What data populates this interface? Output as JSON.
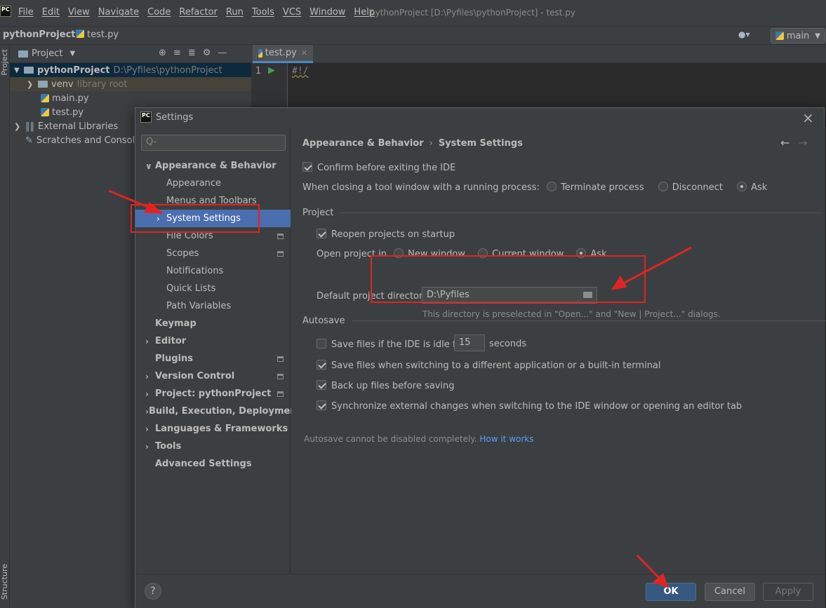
{
  "app": {
    "logo": "PC",
    "menus": [
      "File",
      "Edit",
      "View",
      "Navigate",
      "Code",
      "Refactor",
      "Run",
      "Tools",
      "VCS",
      "Window",
      "Help"
    ],
    "window_title": "pythonProject [D:\\Pyfiles\\pythonProject] - test.py"
  },
  "navbar": {
    "project": "pythonProject",
    "file": "test.py",
    "branch": "main"
  },
  "left_strip": {
    "top": "Project",
    "bottom": "Structure"
  },
  "project_panel": {
    "title": "Project",
    "tree": [
      {
        "label": "pythonProject",
        "extra": "D:\\Pyfiles\\pythonProject"
      },
      {
        "label": "venv",
        "extra": "library root"
      },
      {
        "label": "main.py"
      },
      {
        "label": "test.py"
      },
      {
        "label": "External Libraries"
      },
      {
        "label": "Scratches and Consoles"
      }
    ]
  },
  "editor": {
    "tab": "test.py",
    "line_number": "1",
    "code": "#!/"
  },
  "dialog": {
    "title": "Settings",
    "search_placeholder": "Q-",
    "nav": [
      {
        "label": "Appearance & Behavior"
      },
      {
        "label": "Appearance"
      },
      {
        "label": "Menus and Toolbars"
      },
      {
        "label": "System Settings"
      },
      {
        "label": "File Colors"
      },
      {
        "label": "Scopes"
      },
      {
        "label": "Notifications"
      },
      {
        "label": "Quick Lists"
      },
      {
        "label": "Path Variables"
      },
      {
        "label": "Keymap"
      },
      {
        "label": "Editor"
      },
      {
        "label": "Plugins"
      },
      {
        "label": "Version Control"
      },
      {
        "label": "Project: pythonProject"
      },
      {
        "label": "Build, Execution, Deployment"
      },
      {
        "label": "Languages & Frameworks"
      },
      {
        "label": "Tools"
      },
      {
        "label": "Advanced Settings"
      }
    ],
    "breadcrumb": {
      "parent": "Appearance & Behavior",
      "current": "System Settings"
    },
    "confirm_exit": {
      "label": "Confirm before exiting the IDE",
      "checked": true
    },
    "closing_tool": {
      "label": "When closing a tool window with a running process:",
      "options": [
        "Terminate process",
        "Disconnect",
        "Ask"
      ],
      "selected": "Ask"
    },
    "project_section": {
      "title": "Project",
      "reopen": {
        "label": "Reopen projects on startup",
        "checked": true
      },
      "open_project_in": {
        "label": "Open project in",
        "options": [
          "New window",
          "Current window",
          "Ask"
        ],
        "selected": "Ask"
      },
      "default_dir": {
        "label": "Default project directory:",
        "value": "D:\\Pyfiles"
      },
      "hint": "This directory is preselected in \"Open...\" and \"New | Project...\" dialogs."
    },
    "autosave": {
      "title": "Autosave",
      "idle": {
        "label": "Save files if the IDE is idle for",
        "value": "15",
        "unit": "seconds",
        "checked": false
      },
      "switch_app": {
        "label": "Save files when switching to a different application or a built-in terminal",
        "checked": true
      },
      "backup": {
        "label": "Back up files before saving",
        "checked": true
      },
      "sync": {
        "label": "Synchronize external changes when switching to the IDE window or opening an editor tab",
        "checked": true
      },
      "note": "Autosave cannot be disabled completely.",
      "note_link": "How it works"
    },
    "buttons": {
      "help": "?",
      "ok": "OK",
      "cancel": "Cancel",
      "apply": "Apply"
    }
  },
  "colors": {
    "accent": "#4b6eaf",
    "annotation": "#e02424"
  }
}
